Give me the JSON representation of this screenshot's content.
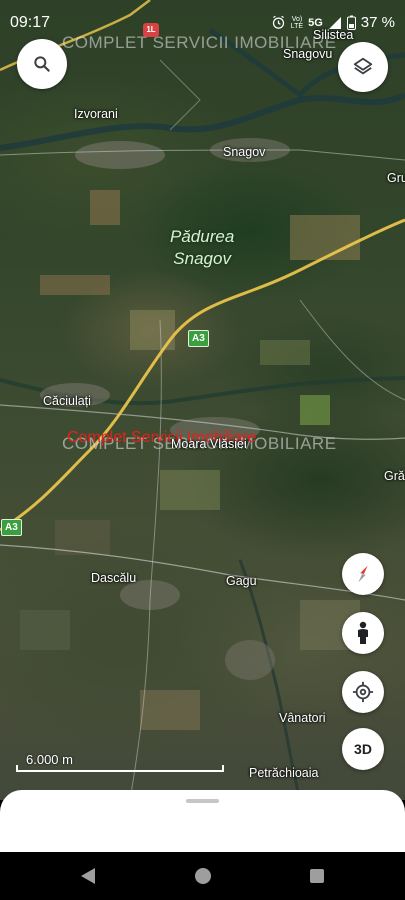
{
  "status_bar": {
    "time": "09:17",
    "network_top": "Vo)",
    "network_bottom": "LTE",
    "network_type": "5G",
    "battery": "37 %"
  },
  "watermark": {
    "top": "COMPLET SERVICII IMOBILIARE",
    "middle": "COMPLET SERVICII IMOBILIARE",
    "overlay_red": "Complet Servicii Imobiliare"
  },
  "map": {
    "places": {
      "silistea": "Silistea",
      "snagovu": "Snagovu",
      "izvorani": "Izvorani",
      "snagov": "Snagov",
      "gr_east": "Gru",
      "caciulati": "Căciulați",
      "moara_vlasiei": "Moara Vlăsiei",
      "gr_east2": "Gră",
      "dascalu": "Dascălu",
      "gagu": "Gagu",
      "vanatori": "Vânatori",
      "petrachioaia": "Petrăchioaia"
    },
    "forest_label_line1": "Pădurea",
    "forest_label_line2": "Snagov",
    "road_shields": {
      "a3_upper": "A3",
      "a3_lower": "A3"
    },
    "route_badge": "1L",
    "scale_label": "6.000 m"
  },
  "controls": {
    "search_icon": "search-icon",
    "layers_icon": "layers-icon",
    "compass_icon": "compass-icon",
    "street_view_icon": "pegman-icon",
    "my_location_icon": "my-location-icon",
    "three_d_label": "3D"
  },
  "colors": {
    "watermark_red": "#e5211c",
    "highway_yellow": "#f2c94c",
    "shield_green": "#3c9f3f"
  }
}
